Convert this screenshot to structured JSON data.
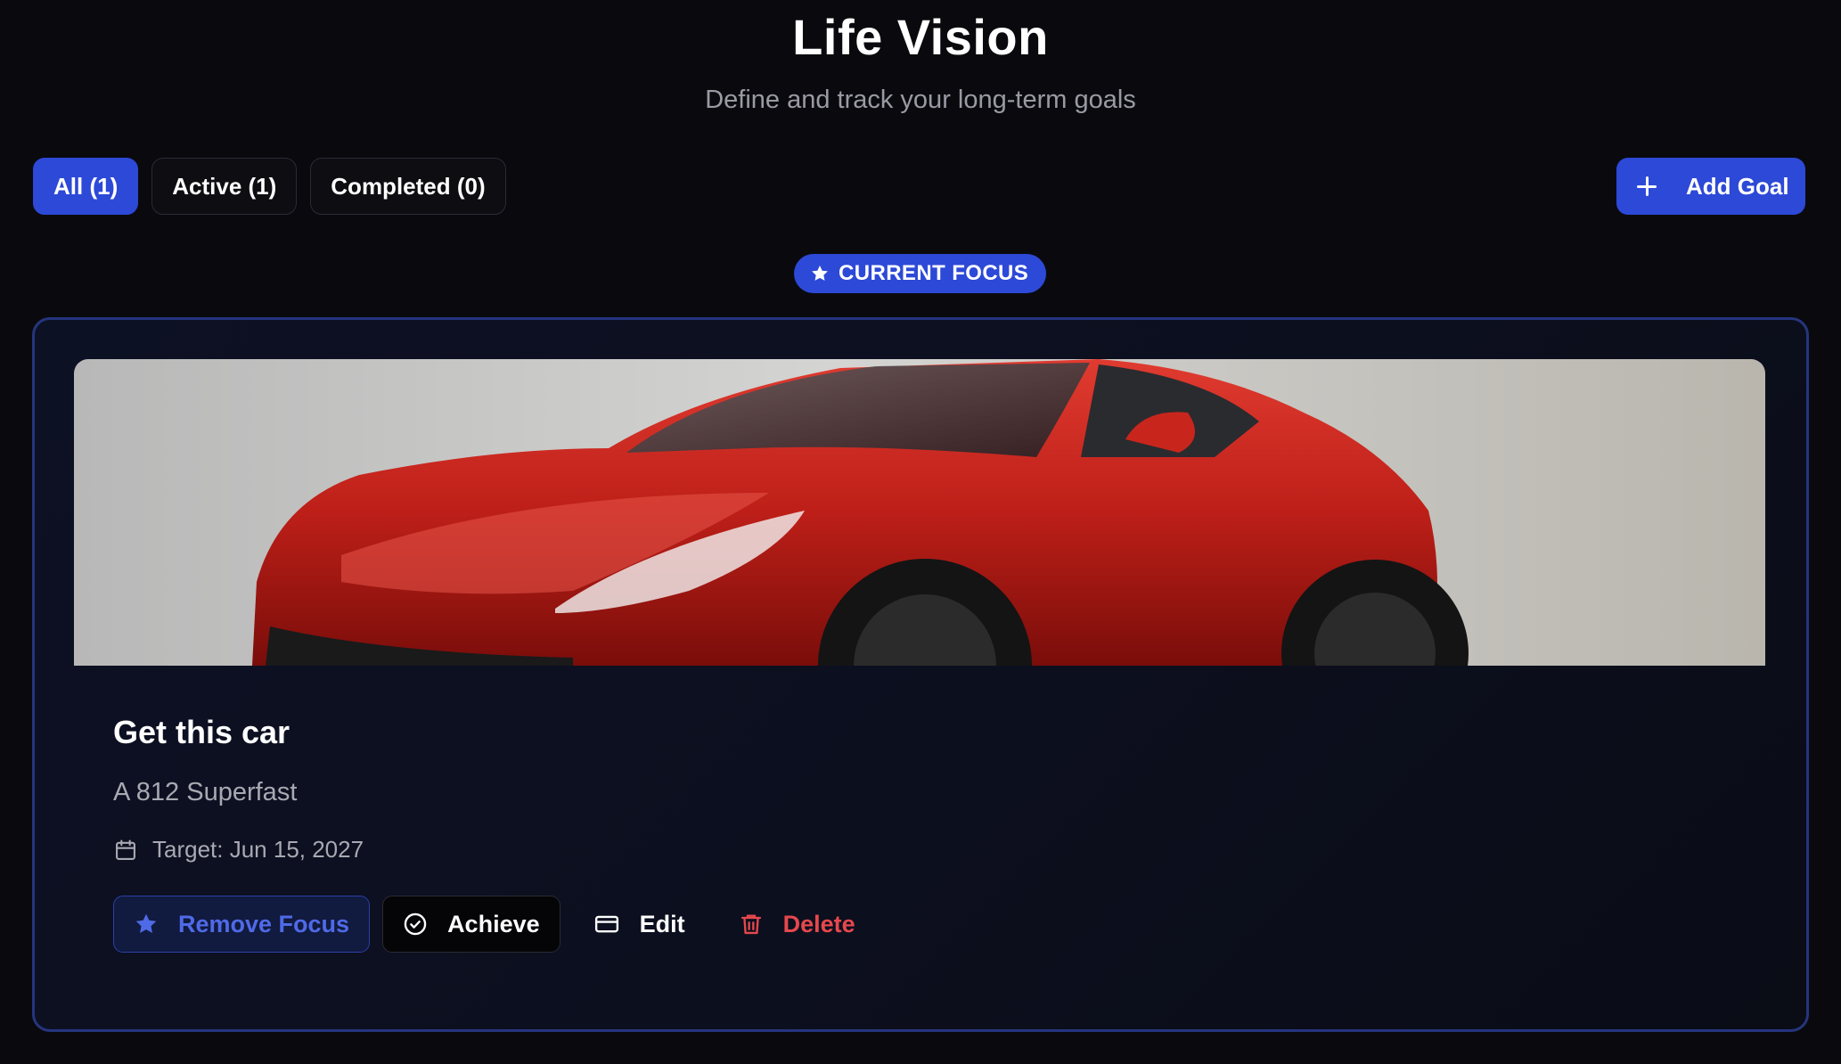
{
  "header": {
    "title": "Life Vision",
    "subtitle": "Define and track your long-term goals"
  },
  "filters": [
    {
      "label": "All (1)",
      "active": true
    },
    {
      "label": "Active (1)",
      "active": false
    },
    {
      "label": "Completed (0)",
      "active": false
    }
  ],
  "toolbar": {
    "add_goal_label": "Add Goal",
    "add_goal_icon": "plus-icon"
  },
  "focus_badge": {
    "label": "CURRENT FOCUS",
    "icon": "star-icon"
  },
  "goal": {
    "image_subject": "red sports car",
    "title": "Get this car",
    "description": "A 812 Superfast",
    "target": "Target: Jun 15, 2027",
    "target_icon": "calendar-icon"
  },
  "actions": {
    "remove_focus_label": "Remove Focus",
    "achieve_label": "Achieve",
    "edit_label": "Edit",
    "delete_label": "Delete"
  },
  "colors": {
    "background": "#0a0a0e",
    "accent": "#2d49d7",
    "card_border": "#25357e",
    "focus_button_text": "#4f6ae6",
    "danger": "#e5484d",
    "muted_text": "#a8a9b2"
  }
}
